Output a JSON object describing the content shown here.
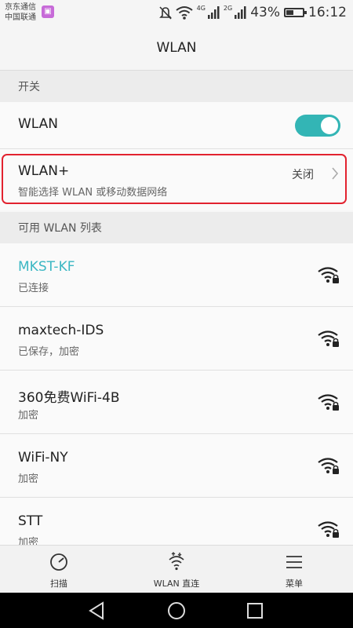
{
  "status_bar": {
    "carrier_line1": "京东通信",
    "carrier_line2": "中国联通",
    "network1": "4G",
    "network2": "2G",
    "battery_percent": "43%",
    "battery_level": 0.43,
    "time": "16:12"
  },
  "header": {
    "title": "WLAN"
  },
  "switch_section": {
    "header": "开关",
    "wlan_label": "WLAN",
    "wlan_enabled": true,
    "wlan_plus_label": "WLAN+",
    "wlan_plus_desc": "智能选择 WLAN 或移动数据网络",
    "wlan_plus_status": "关闭"
  },
  "networks_section": {
    "header": "可用 WLAN 列表",
    "networks": [
      {
        "name": "MKST-KF",
        "status": "已连接",
        "connected": true
      },
      {
        "name": "maxtech-IDS",
        "status": "已保存，加密",
        "connected": false
      },
      {
        "name": "360免费WiFi-4B",
        "status": "加密",
        "connected": false
      },
      {
        "name": "WiFi-NY",
        "status": "加密",
        "connected": false
      },
      {
        "name": "STT",
        "status": "加密",
        "connected": false
      }
    ]
  },
  "toolbar": {
    "scan_label": "扫描",
    "direct_label": "WLAN 直连",
    "menu_label": "菜单"
  },
  "colors": {
    "accent": "#33b5b5",
    "connected_text": "#3bb7c3",
    "highlight": "#e2222f"
  }
}
